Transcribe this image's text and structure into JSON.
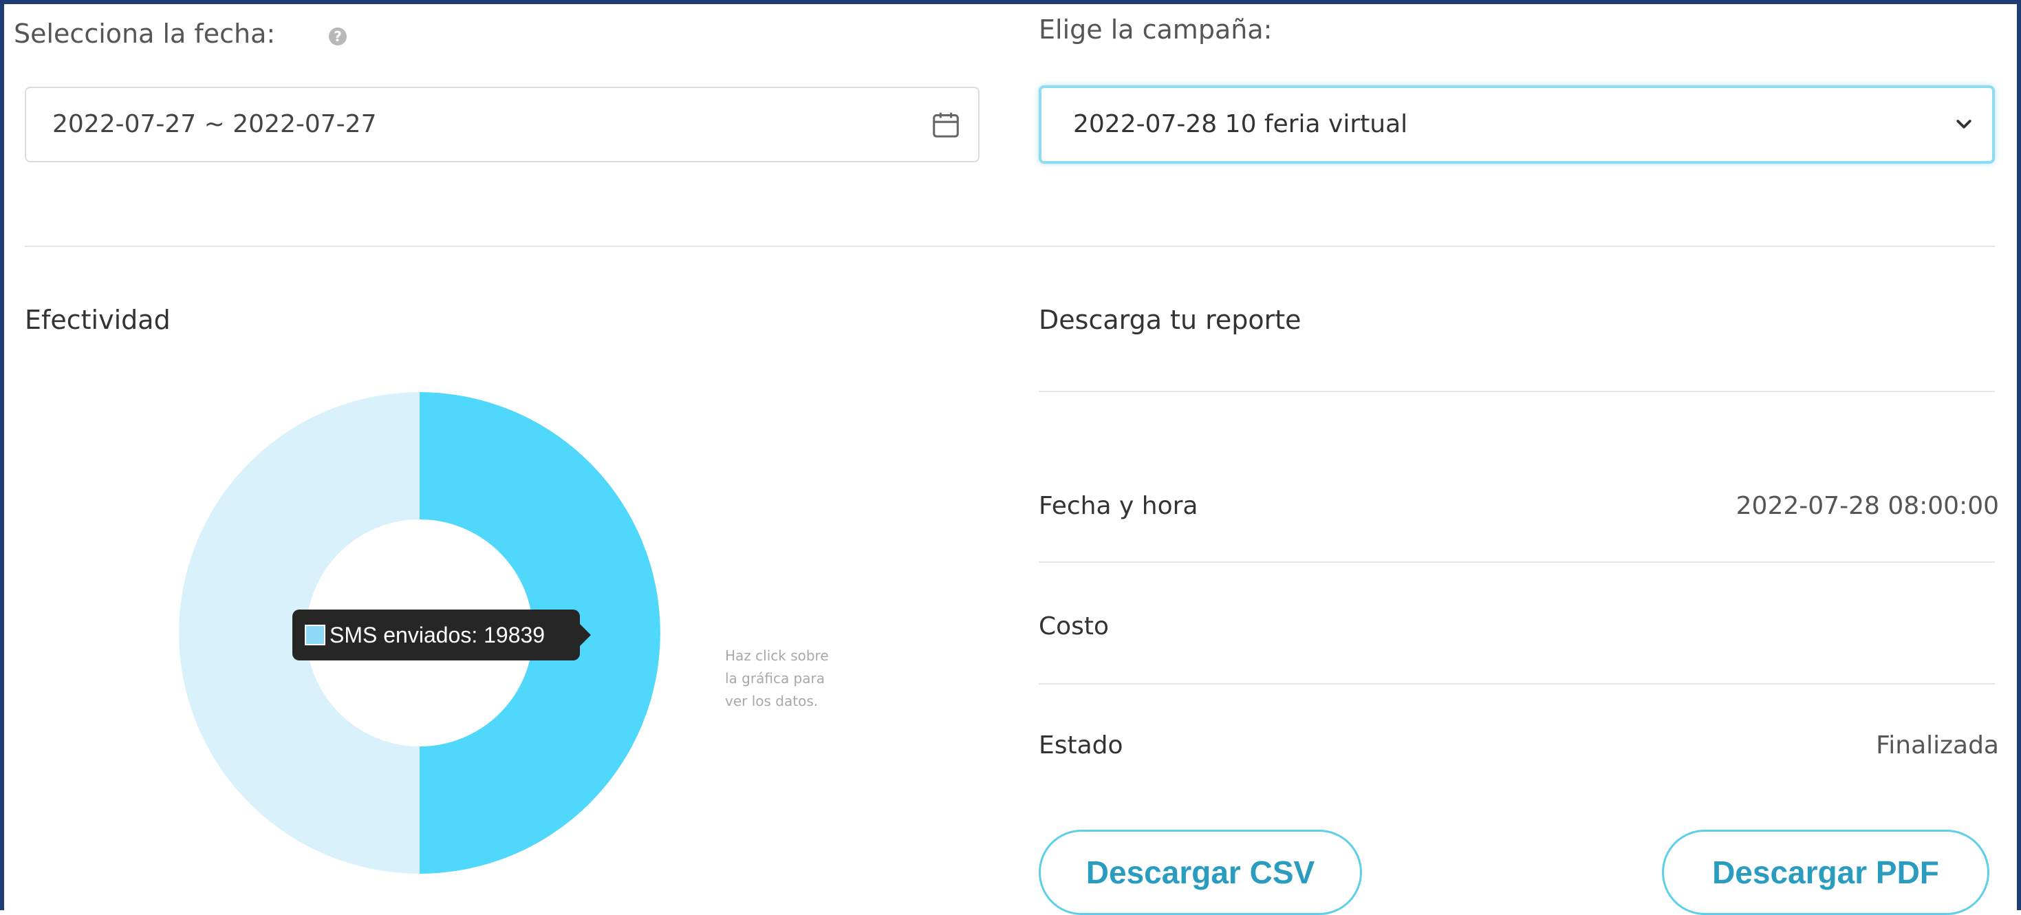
{
  "filters": {
    "date_label": "Selecciona la fecha:",
    "date_help_glyph": "?",
    "date_range_value": "2022-07-27 ~ 2022-07-27",
    "campaign_label": "Elige la campaña:",
    "campaign_selected": "2022-07-28 10 feria virtual"
  },
  "effectiveness": {
    "title": "Efectividad",
    "tooltip": "SMS enviados: 19839",
    "hint_lines": [
      "Haz click sobre",
      "la gráfica para",
      "ver los datos."
    ]
  },
  "chart_data": {
    "type": "pie",
    "style": "donut",
    "series": [
      {
        "name": "SMS enviados",
        "value": 19839,
        "share": 0.5,
        "color": "#4fd8fb"
      },
      {
        "value": null,
        "share": 0.5,
        "color": "#d8f1fb"
      }
    ]
  },
  "report": {
    "title": "Descarga tu reporte",
    "rows": [
      {
        "label": "Fecha y hora",
        "value": "2022-07-28 08:00:00"
      },
      {
        "label": "Costo",
        "value": ""
      },
      {
        "label": "Estado",
        "value": "Finalizada"
      }
    ],
    "csv_button": "Descargar CSV",
    "pdf_button": "Descargar PDF"
  },
  "icons": {
    "date_help": "help-circle-icon",
    "date_picker": "calendar-icon",
    "campaign_dropdown": "chevron-down-icon"
  },
  "colors": {
    "accent": "#4fd8fb",
    "accent_light": "#d8f1fb",
    "button_text": "#2a9cbf",
    "frame": "#1f3d73"
  }
}
